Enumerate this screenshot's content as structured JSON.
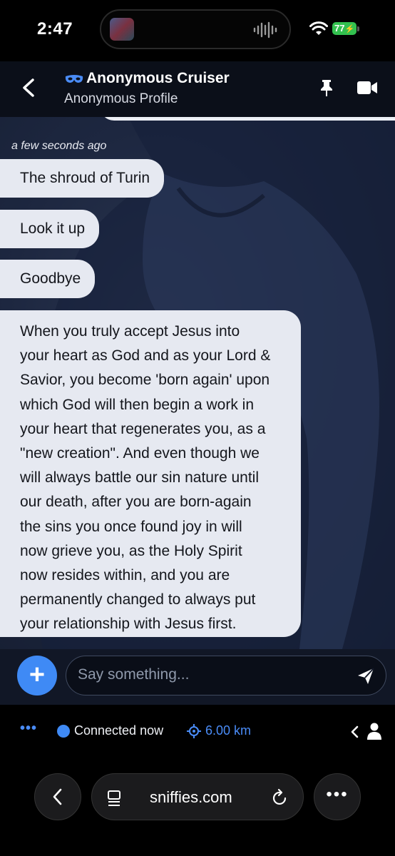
{
  "status_bar": {
    "time": "2:47",
    "battery": "77"
  },
  "header": {
    "title": "Anonymous Cruiser",
    "subtitle": "Anonymous Profile",
    "icons": [
      "back-chevron",
      "mask",
      "pin",
      "video-camera"
    ]
  },
  "chat": {
    "timestamp": "a few seconds ago",
    "messages": [
      {
        "text": "The shroud of Turin"
      },
      {
        "text": "Look it up"
      },
      {
        "text": "Goodbye"
      },
      {
        "lines": [
          "When you truly accept Jesus into",
          "your heart as God and as your Lord &",
          "Savior, you become 'born again' upon",
          "which God will then begin a work in",
          "your heart that regenerates you, as a",
          "\"new creation\". And even though we",
          "will always battle our sin nature until",
          "our death, after you are born-again",
          "the sins you once found joy in will",
          "now grieve you, as the Holy Spirit",
          "now resides within, and you are",
          "permanently changed to always put",
          "your relationship with Jesus first."
        ]
      }
    ]
  },
  "composer": {
    "placeholder": "Say something...",
    "plus": "+"
  },
  "footer": {
    "dots": "•••",
    "status": "Connected now",
    "distance": "6.00 km"
  },
  "browser": {
    "url": "sniffies.com",
    "more": "•••"
  },
  "colors": {
    "accent": "#3f8af5",
    "bubble": "#e6e9f1",
    "header": "#0b0f19"
  }
}
